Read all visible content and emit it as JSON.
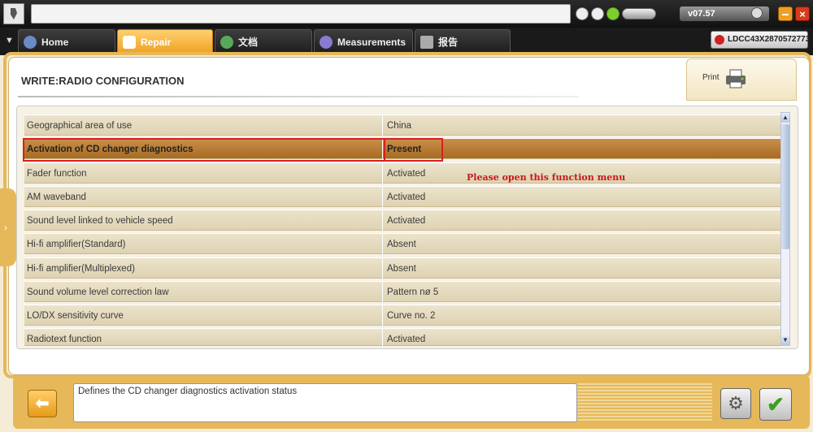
{
  "header": {
    "version": "v07.57"
  },
  "tabs": [
    {
      "label": "Home",
      "active": false
    },
    {
      "label": "Repair",
      "active": true
    },
    {
      "label": "文档",
      "active": false
    },
    {
      "label": "Measurements",
      "active": false
    },
    {
      "label": "报告",
      "active": false
    }
  ],
  "vin": "LDCC43X2870572773",
  "page": {
    "title": "WRITE:RADIO CONFIGURATION",
    "print_label": "Print"
  },
  "rows": [
    {
      "name": "Geographical area of use",
      "value": "China"
    },
    {
      "name": "Activation of CD changer diagnostics",
      "value": "Present"
    },
    {
      "name": "Fader function",
      "value": "Activated"
    },
    {
      "name": "AM waveband",
      "value": "Activated"
    },
    {
      "name": "Sound level linked to vehicle speed",
      "value": "Activated"
    },
    {
      "name": "Hi-fi amplifier(Standard)",
      "value": "Absent"
    },
    {
      "name": "Hi-fi amplifier(Multiplexed)",
      "value": "Absent"
    },
    {
      "name": "Sound volume level correction law",
      "value": "Pattern nø 5"
    },
    {
      "name": "LO/DX sensitivity curve",
      "value": "Curve no. 2"
    },
    {
      "name": "Radiotext function",
      "value": "Activated"
    }
  ],
  "selected_row": 1,
  "annotation": "Please open this function menu",
  "description": "Defines the CD changer diagnostics activation status",
  "colors": {
    "accent": "#e6b85a",
    "selected_row": "#b07a30",
    "annotation": "#c81818"
  }
}
